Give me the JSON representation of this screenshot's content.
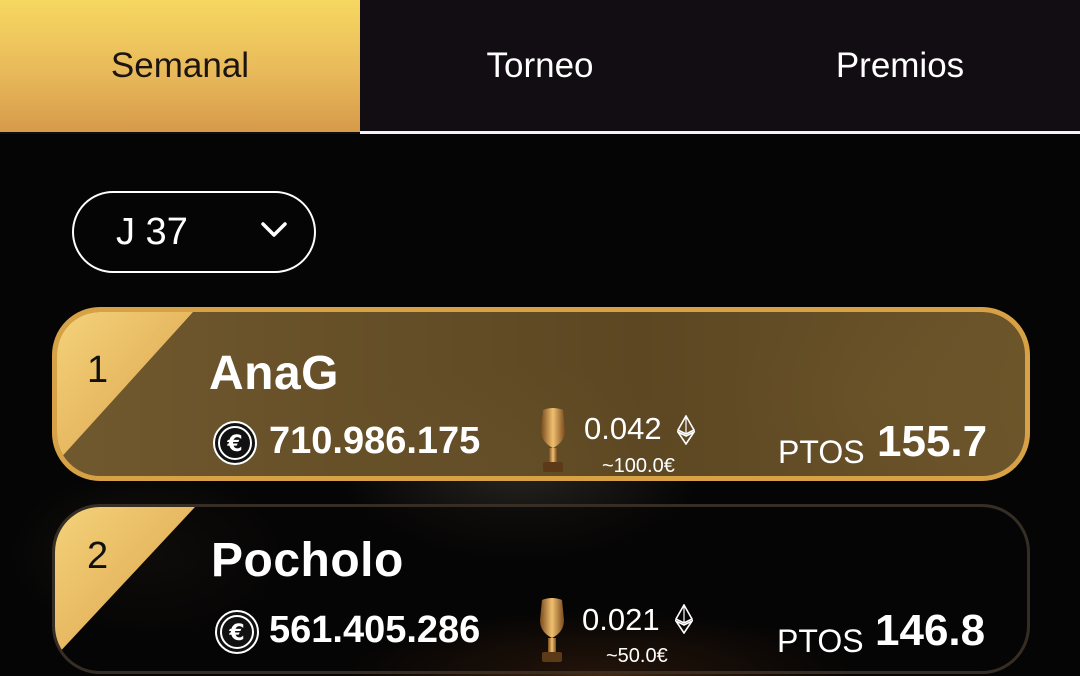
{
  "tabs": [
    {
      "label": "Semanal",
      "active": true
    },
    {
      "label": "Torneo",
      "active": false
    },
    {
      "label": "Premios",
      "active": false
    }
  ],
  "round_select": {
    "value": "J 37"
  },
  "leaderboard": [
    {
      "rank": "1",
      "name": "AnaG",
      "balance": "710.986.175",
      "eth": "0.042",
      "eur": "~100.0€",
      "points_label": "PTOS",
      "points": "155.7",
      "highlighted": true
    },
    {
      "rank": "2",
      "name": "Pocholo",
      "balance": "561.405.286",
      "eth": "0.021",
      "eur": "~50.0€",
      "points_label": "PTOS",
      "points": "146.8",
      "highlighted": false
    }
  ],
  "colors": {
    "accent": "#e8b95a",
    "accent_dark": "#d79a4a",
    "tab_bar": "#120d12"
  },
  "icons": {
    "coin": "euro-coin-icon",
    "trophy": "trophy-icon",
    "eth": "ethereum-icon",
    "chevron": "chevron-down-icon"
  }
}
